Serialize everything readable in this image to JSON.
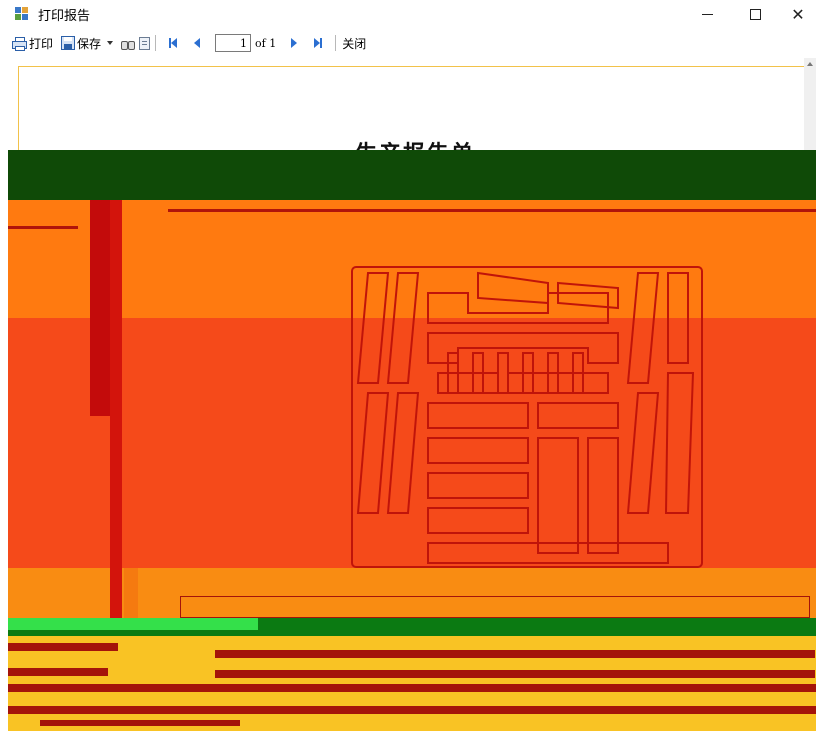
{
  "window": {
    "title": "打印报告",
    "minimize_icon": "minimize-icon",
    "maximize_icon": "maximize-icon",
    "close_icon": "close-icon",
    "close_glyph": "✕"
  },
  "toolbar": {
    "print_label": "打印",
    "save_label": "保存",
    "page_number": "1",
    "page_total": "of 1",
    "close_label": "关闭",
    "icons": [
      "printer-icon",
      "save-icon",
      "dropdown-arrow-icon",
      "binoculars-icon",
      "page-setup-icon",
      "first-page-icon",
      "previous-page-icon",
      "next-page-icon",
      "last-page-icon"
    ]
  },
  "report": {
    "title": "生产报告单"
  },
  "colors": {
    "accent_blue": "#2b6fd1",
    "artifact_dark_green": "#0f4a07",
    "artifact_orange": "#ff7a10",
    "artifact_red": "#f54a1a",
    "artifact_yellow": "#f9c324"
  }
}
